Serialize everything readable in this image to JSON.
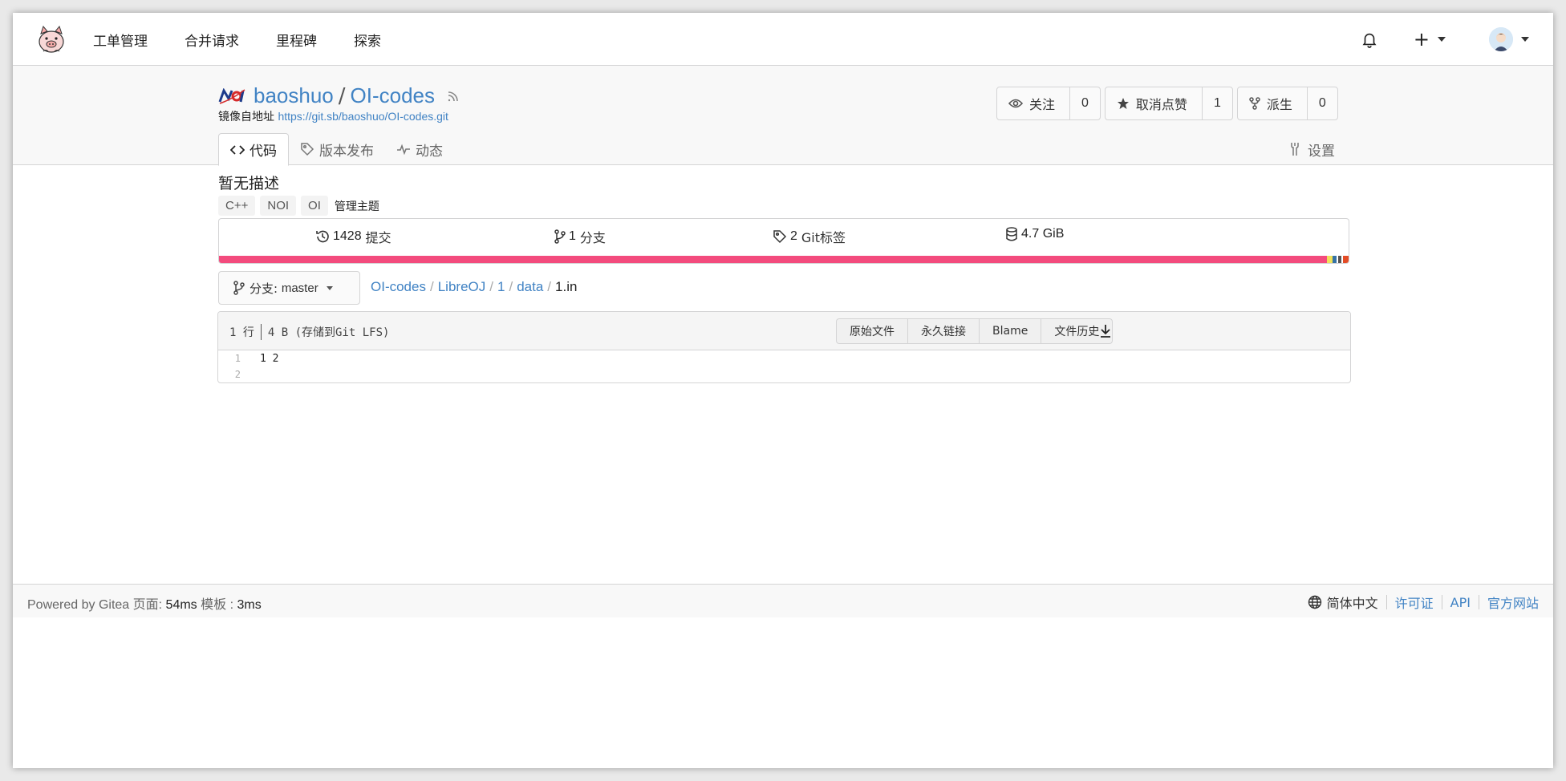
{
  "nav": {
    "items": [
      "工单管理",
      "合并请求",
      "里程碑",
      "探索"
    ],
    "plus": "+"
  },
  "repo": {
    "owner": "baoshuo",
    "separator": "/",
    "name": "OI-codes",
    "mirror_label": "镜像自地址",
    "mirror_url": "https://git.sb/baoshuo/OI-codes.git",
    "buttons": [
      {
        "label": "关注",
        "count": "0"
      },
      {
        "label": "取消点赞",
        "count": "1"
      },
      {
        "label": "派生",
        "count": "0"
      }
    ]
  },
  "tabs": {
    "code": "代码",
    "releases": "版本发布",
    "activity": "动态",
    "settings": "设置"
  },
  "description": "暂无描述",
  "topics": [
    "C++",
    "NOI",
    "OI"
  ],
  "manage_topics": "管理主题",
  "stats": {
    "commits_num": "1428",
    "commits_label": "提交",
    "branches_num": "1",
    "branches_label": "分支",
    "tags_num": "2",
    "tags_label": "Git标签",
    "size": "4.7 GiB"
  },
  "language_bar": [
    {
      "color": "#f34b7d",
      "fraction": 0.9806
    },
    {
      "color": "#f1e05a",
      "fraction": 0.0055
    },
    {
      "color": "#3572A5",
      "fraction": 0.0035
    },
    {
      "color": "#ffffff",
      "fraction": 0.0014
    },
    {
      "color": "#555555",
      "fraction": 0.0028
    },
    {
      "color": "#ffffff",
      "fraction": 0.0014
    },
    {
      "color": "#e34c26",
      "fraction": 0.0048
    }
  ],
  "branch": {
    "label": "分支:",
    "name": "master"
  },
  "breadcrumb": {
    "parts": [
      "OI-codes",
      "LibreOJ",
      "1",
      "data"
    ],
    "current": "1.in",
    "slash": "/"
  },
  "file": {
    "lines_info": "1 行",
    "size_info": "4 B (存储到Git LFS)",
    "actions": [
      "原始文件",
      "永久链接",
      "Blame",
      "文件历史"
    ],
    "code_lines": [
      {
        "num": "1",
        "text": "1 2"
      },
      {
        "num": "2",
        "text": ""
      }
    ]
  },
  "footer": {
    "powered": "Powered by Gitea",
    "page_label": "页面:",
    "page_time": "54ms",
    "template_label": "模板 :",
    "template_time": "3ms",
    "language": "简体中文",
    "license": "许可证",
    "api": "API",
    "website": "官方网站"
  }
}
